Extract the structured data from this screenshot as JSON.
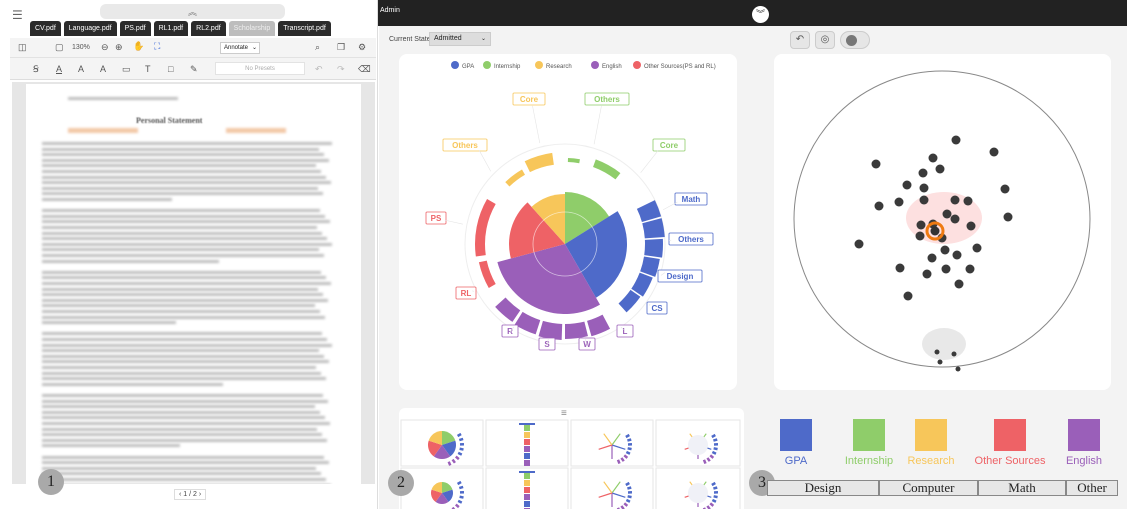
{
  "left_panel": {
    "tabs": [
      {
        "label": "CV.pdf",
        "active": false
      },
      {
        "label": "Language.pdf",
        "active": false
      },
      {
        "label": "PS.pdf",
        "active": false
      },
      {
        "label": "RL1.pdf",
        "active": false
      },
      {
        "label": "RL2.pdf",
        "active": false
      },
      {
        "label": "Scholarship",
        "active": true
      },
      {
        "label": "Transcript.pdf",
        "active": false
      }
    ],
    "zoom": "130%",
    "annotate_label": "Annotate",
    "presets_placeholder": "No Presets",
    "document_title": "Personal Statement",
    "page_indicator": "1 / 2",
    "badge": "1"
  },
  "top_bar": {
    "user": "Admin"
  },
  "middle_panel": {
    "current_state_label": "Current State",
    "current_state_value": "Admitted",
    "legend": [
      {
        "label": "GPA",
        "color": "#4e6ac9"
      },
      {
        "label": "Internship",
        "color": "#8fcd6a"
      },
      {
        "label": "Research",
        "color": "#f7c65a"
      },
      {
        "label": "English",
        "color": "#9a5fb9"
      },
      {
        "label": "Other Sources(PS and RL)",
        "color": "#ee6266"
      }
    ],
    "ring_labels": [
      {
        "text": "Core",
        "color": "#f7c65a"
      },
      {
        "text": "Others",
        "color": "#8fcd6a"
      },
      {
        "text": "Core",
        "color": "#8fcd6a"
      },
      {
        "text": "Math",
        "color": "#4e6ac9"
      },
      {
        "text": "Others",
        "color": "#4e6ac9"
      },
      {
        "text": "Design",
        "color": "#4e6ac9"
      },
      {
        "text": "CS",
        "color": "#4e6ac9"
      },
      {
        "text": "L",
        "color": "#9a5fb9"
      },
      {
        "text": "W",
        "color": "#9a5fb9"
      },
      {
        "text": "S",
        "color": "#9a5fb9"
      },
      {
        "text": "R",
        "color": "#9a5fb9"
      },
      {
        "text": "RL",
        "color": "#ee6266"
      },
      {
        "text": "PS",
        "color": "#ee6266"
      },
      {
        "text": "Others",
        "color": "#f7c65a"
      }
    ],
    "badge": "2"
  },
  "right_panel": {
    "legend": [
      {
        "label": "GPA",
        "color": "#4e6ac9"
      },
      {
        "label": "Internship",
        "color": "#8fcd6a"
      },
      {
        "label": "Research",
        "color": "#f7c65a"
      },
      {
        "label": "Other Sources",
        "color": "#ee6266"
      },
      {
        "label": "English",
        "color": "#9a5fb9"
      }
    ],
    "bottom_tabs": [
      "Design",
      "Computer",
      "Math",
      "Other"
    ],
    "badge": "3"
  }
}
